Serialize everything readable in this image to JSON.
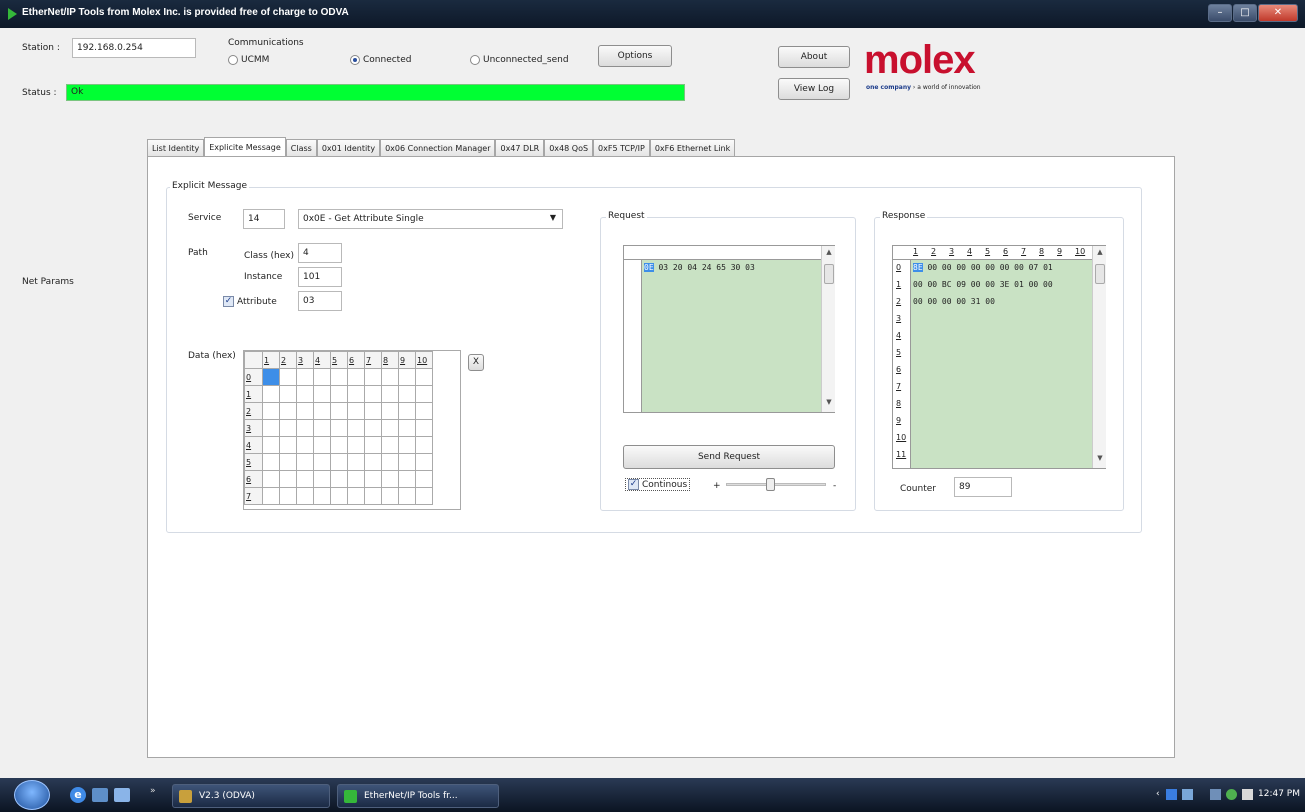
{
  "window": {
    "title": "EtherNet/IP Tools from Molex Inc. is provided free of charge to ODVA"
  },
  "station": {
    "label": "Station :",
    "value": "192.168.0.254"
  },
  "status": {
    "label": "Status :",
    "value": "Ok",
    "color": "#00ff33"
  },
  "communications": {
    "label": "Communications",
    "options": [
      "UCMM",
      "Connected",
      "Unconnected_send"
    ],
    "selected": "Connected"
  },
  "buttons": {
    "options": "Options",
    "about": "About",
    "view_log": "View Log"
  },
  "brand": {
    "logo": "molex",
    "tagline_bold": "one company",
    "tagline_rest": " › a world of innovation",
    "color": "#c8102e"
  },
  "sidebar": {
    "net_params": "Net Params"
  },
  "tabs": [
    "List Identity",
    "Explicite Message",
    "Class",
    "0x01 Identity",
    "0x06 Connection Manager",
    "0x47 DLR",
    "0x48 QoS",
    "0xF5 TCP/IP",
    "0xF6 Ethernet Link"
  ],
  "active_tab": "Explicite Message",
  "explicit": {
    "group_title": "Explicit Message",
    "service_label": "Service",
    "service_code": "14",
    "service_select": "0x0E - Get Attribute Single",
    "path_label": "Path",
    "class_label": "Class (hex)",
    "class_value": "4",
    "instance_label": "Instance",
    "instance_value": "101",
    "attribute_label": "Attribute",
    "attribute_checked": true,
    "attribute_value": "03",
    "data_label": "Data (hex)",
    "clear_button": "X"
  },
  "data_grid": {
    "columns": [
      "1",
      "2",
      "3",
      "4",
      "5",
      "6",
      "7",
      "8",
      "9",
      "10"
    ],
    "rows": [
      "0",
      "1",
      "2",
      "3",
      "4",
      "5",
      "6",
      "7"
    ]
  },
  "request": {
    "group_title": "Request",
    "first_cell": "0E",
    "row0_rest": "03 20 04 24 65 30 03",
    "send_button": "Send Request",
    "continuous_label": "Continous",
    "continuous_checked": true,
    "slider_plus": "+",
    "slider_minus": "-"
  },
  "response": {
    "group_title": "Response",
    "columns": [
      "1",
      "2",
      "3",
      "4",
      "5",
      "6",
      "7",
      "8",
      "9",
      "10"
    ],
    "row_indices": [
      "0",
      "1",
      "2",
      "3",
      "4",
      "5",
      "6",
      "7",
      "8",
      "9",
      "10",
      "11"
    ],
    "first_cell": "8E",
    "rows_text": [
      "00 00 00 00 00 00 00 07 01",
      "00 00 BC 09 00 00 3E 01 00 00",
      "00 00 00 00 31 00"
    ],
    "counter_label": "Counter",
    "counter_value": "89"
  },
  "taskbar": {
    "item1": "V2.3 (ODVA)",
    "item2": "EtherNet/IP Tools fr...",
    "clock": "12:47 PM"
  }
}
